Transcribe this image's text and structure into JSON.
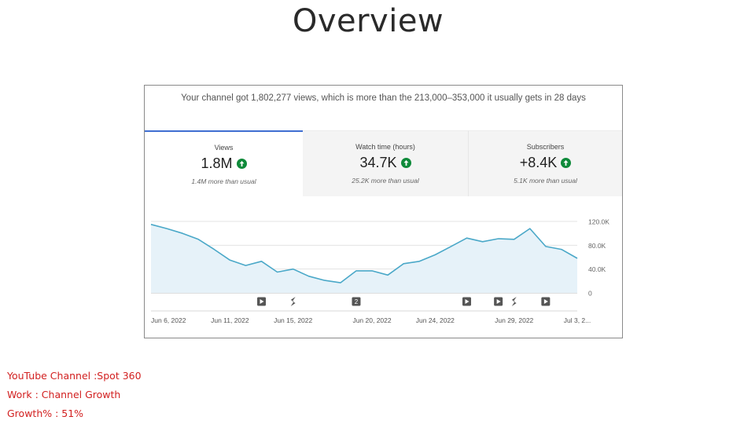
{
  "page": {
    "title": "Overview"
  },
  "summary": {
    "text": "Your channel got 1,802,277 views, which is more than the 213,000–353,000 it usually gets in 28 days"
  },
  "tabs": [
    {
      "label": "Views",
      "value": "1.8M",
      "note": "1.4M more than usual",
      "selected": true
    },
    {
      "label": "Watch time (hours)",
      "value": "34.7K",
      "note": "25.2K more than usual",
      "selected": false
    },
    {
      "label": "Subscribers",
      "value": "+8.4K",
      "note": "5.1K more than usual",
      "selected": false
    }
  ],
  "chart_data": {
    "type": "area",
    "series": [
      {
        "values": [
          115000,
          108000,
          100000,
          90000,
          73000,
          55000,
          46000,
          53000,
          35000,
          40000,
          28000,
          21000,
          17000,
          37000,
          37000,
          30000,
          49000,
          53000,
          64000,
          78000,
          92000,
          86000,
          91000,
          90000,
          108000,
          78000,
          73000,
          58000
        ]
      }
    ],
    "y_ticks": [
      "120.0K",
      "80.0K",
      "40.0K",
      "0"
    ],
    "y_tick_values": [
      120000,
      80000,
      40000,
      0
    ],
    "ylim": [
      0,
      120000
    ],
    "x_tick_labels": [
      "Jun 6, 2022",
      "Jun 11, 2022",
      "Jun 15, 2022",
      "Jun 20, 2022",
      "Jun 24, 2022",
      "Jun 29, 2022",
      "Jul 3, 2..."
    ],
    "x_tick_index": [
      0,
      5,
      9,
      14,
      18,
      23,
      27
    ],
    "markers": [
      {
        "day_index": 7,
        "kind": "play-icon",
        "text": ""
      },
      {
        "day_index": 9,
        "kind": "shorts-icon",
        "text": ""
      },
      {
        "day_index": 13,
        "kind": "number-badge",
        "text": "2"
      },
      {
        "day_index": 20,
        "kind": "play-icon",
        "text": ""
      },
      {
        "day_index": 22,
        "kind": "play-icon",
        "text": ""
      },
      {
        "day_index": 23,
        "kind": "shorts-icon",
        "text": ""
      },
      {
        "day_index": 25,
        "kind": "play-icon",
        "text": ""
      }
    ],
    "grid": true,
    "line_color": "#4aa8c8",
    "fill_color": "#e6f2f9"
  },
  "footer": {
    "channel": "YouTube Channel :Spot 360",
    "work": "Work : Channel Growth",
    "growth": "Growth% : 51%"
  },
  "colors": {
    "accent": "#3f6ed1",
    "up_badge": "#0f8a3a",
    "footer_text": "#d22020"
  }
}
